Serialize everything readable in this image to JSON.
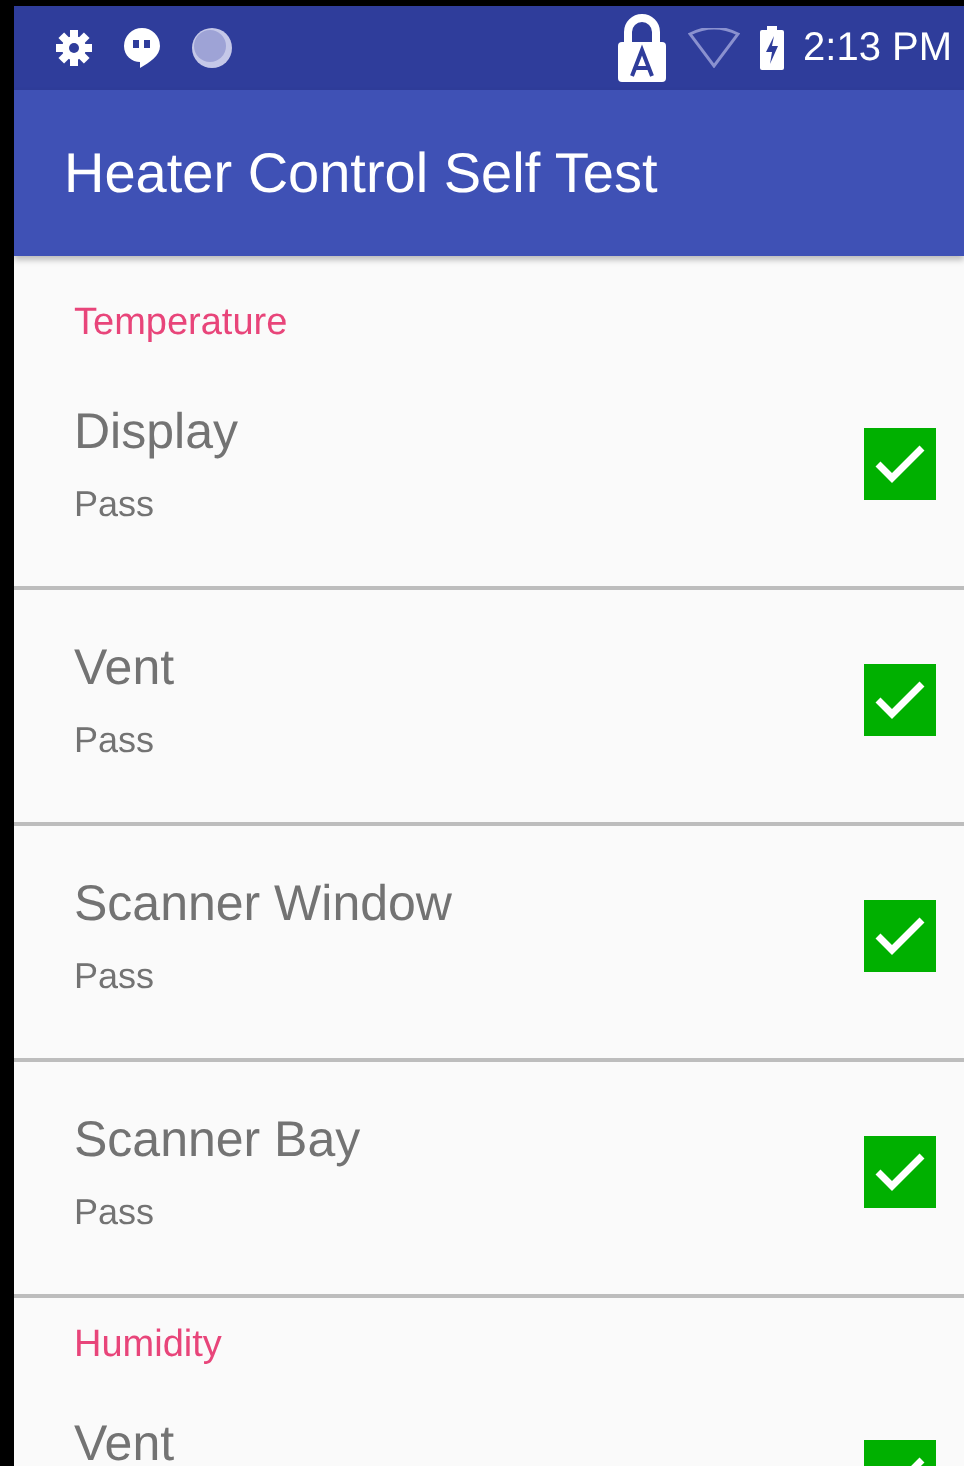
{
  "status_bar": {
    "time": "2:13 PM"
  },
  "app_bar": {
    "title": "Heater Control Self Test"
  },
  "sections": [
    {
      "title": "Temperature",
      "items": [
        {
          "title": "Display",
          "summary": "Pass",
          "checked": true
        },
        {
          "title": "Vent",
          "summary": "Pass",
          "checked": true
        },
        {
          "title": "Scanner Window",
          "summary": "Pass",
          "checked": true
        },
        {
          "title": "Scanner Bay",
          "summary": "Pass",
          "checked": true
        }
      ]
    },
    {
      "title": "Humidity",
      "items": [
        {
          "title": "Vent",
          "checked": true
        }
      ]
    }
  ]
}
